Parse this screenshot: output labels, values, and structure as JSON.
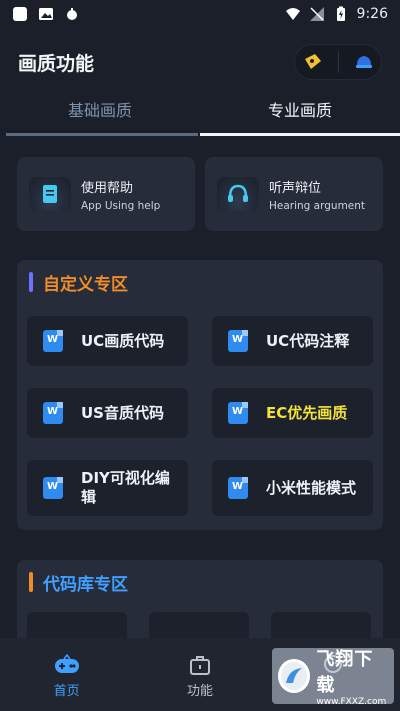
{
  "status_bar": {
    "time": "9:26"
  },
  "header": {
    "title": "画质功能"
  },
  "tabs": [
    {
      "label": "基础画质",
      "active": false
    },
    {
      "label": "专业画质",
      "active": true
    }
  ],
  "quick_actions": [
    {
      "title": "使用帮助",
      "subtitle": "App Using help",
      "icon": "document-icon"
    },
    {
      "title": "听声辩位",
      "subtitle": "Hearing argument",
      "icon": "headphones-icon"
    }
  ],
  "custom_section": {
    "title": "自定义专区",
    "accent": "#6a73ff",
    "title_color": "#f08c2a",
    "items": [
      {
        "label": "UC画质代码",
        "highlight": false
      },
      {
        "label": "UC代码注释",
        "highlight": false
      },
      {
        "label": "US音质代码",
        "highlight": false
      },
      {
        "label": "EC优先画质",
        "highlight": true
      },
      {
        "label": "DIY可视化编辑",
        "highlight": false
      },
      {
        "label": "小米性能模式",
        "highlight": false
      }
    ]
  },
  "library_section": {
    "title": "代码库专区",
    "accent": "#f08c2a",
    "title_color": "#3fa0ff"
  },
  "bottom_nav": [
    {
      "label": "首页",
      "active": true,
      "icon": "gamepad-icon"
    },
    {
      "label": "功能",
      "active": false,
      "icon": "briefcase-icon"
    },
    {
      "label": "",
      "active": false,
      "icon": "profile-icon"
    }
  ],
  "watermark": {
    "main": "飞翔下载",
    "sub": "www.FXXZ.com"
  },
  "colors": {
    "background": "#1b1f2a",
    "card": "#262c39",
    "accent_blue": "#3fa0ff",
    "highlight_yellow": "#f4e23a"
  }
}
